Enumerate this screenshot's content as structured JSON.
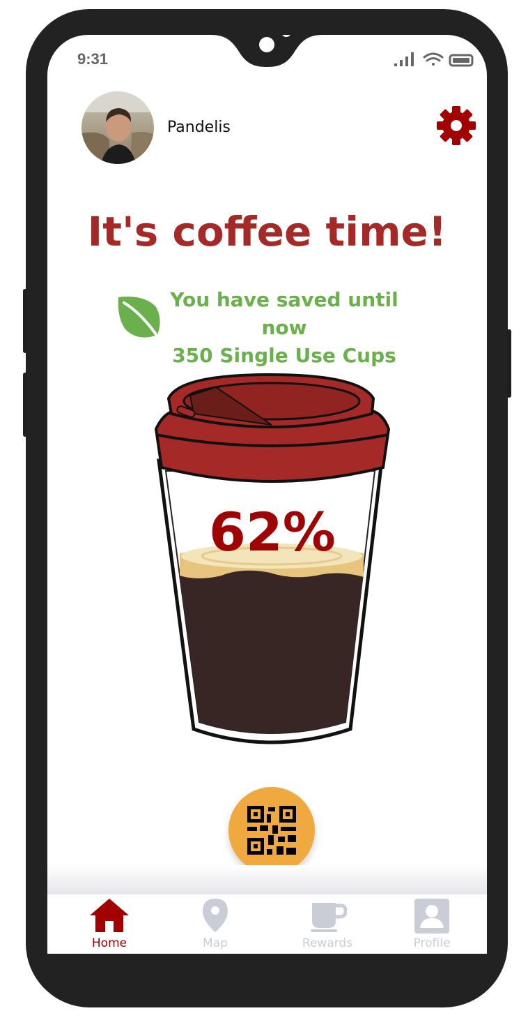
{
  "status_bar": {
    "time": "9:31"
  },
  "user": {
    "name": "Pandelis"
  },
  "main": {
    "headline": "It's coffee time!",
    "saved_line1": "You have saved until now",
    "saved_line2": "350 Single Use Cups",
    "fill_percent_label": "62%",
    "fill_fraction": 0.62
  },
  "nav": {
    "items": [
      {
        "label": "Home",
        "icon": "home-icon",
        "active": true
      },
      {
        "label": "Map",
        "icon": "map-pin-icon",
        "active": false
      },
      {
        "label": "Rewards",
        "icon": "coffee-cup-icon",
        "active": false
      },
      {
        "label": "Profile",
        "icon": "profile-icon",
        "active": false
      }
    ]
  },
  "colors": {
    "accent": "#a52a27",
    "leaf_green": "#6ab04c",
    "qr_button": "#efa93e",
    "nav_inactive": "#c9ced6",
    "nav_active": "#a20000"
  }
}
